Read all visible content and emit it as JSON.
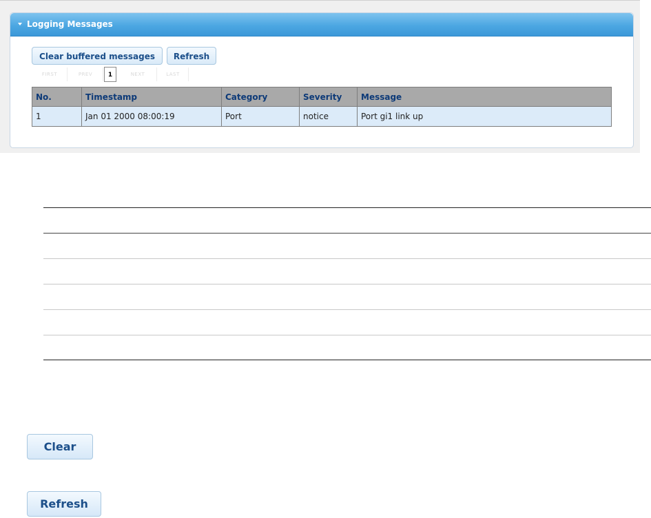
{
  "panel": {
    "title": "Logging Messages",
    "buttons": {
      "clear_buffered": "Clear buffered messages",
      "refresh": "Refresh"
    },
    "pager": {
      "first": "FIRST",
      "prev": "PREV",
      "current": "1",
      "next": "NEXT",
      "last": "LAST"
    },
    "table": {
      "columns": [
        "No.",
        "Timestamp",
        "Category",
        "Severity",
        "Message"
      ],
      "rows": [
        [
          "1",
          "Jan 01 2000 08:00:19",
          "Port",
          "notice",
          "Port gi1 link up"
        ]
      ]
    }
  },
  "bottom_buttons": {
    "clear": "Clear",
    "refresh": "Refresh"
  },
  "colors": {
    "header_blue": "#4ca7e2",
    "table_header_gray": "#a9a9a9",
    "row_blue": "#dcebf9",
    "button_text": "#1c4f8a"
  }
}
